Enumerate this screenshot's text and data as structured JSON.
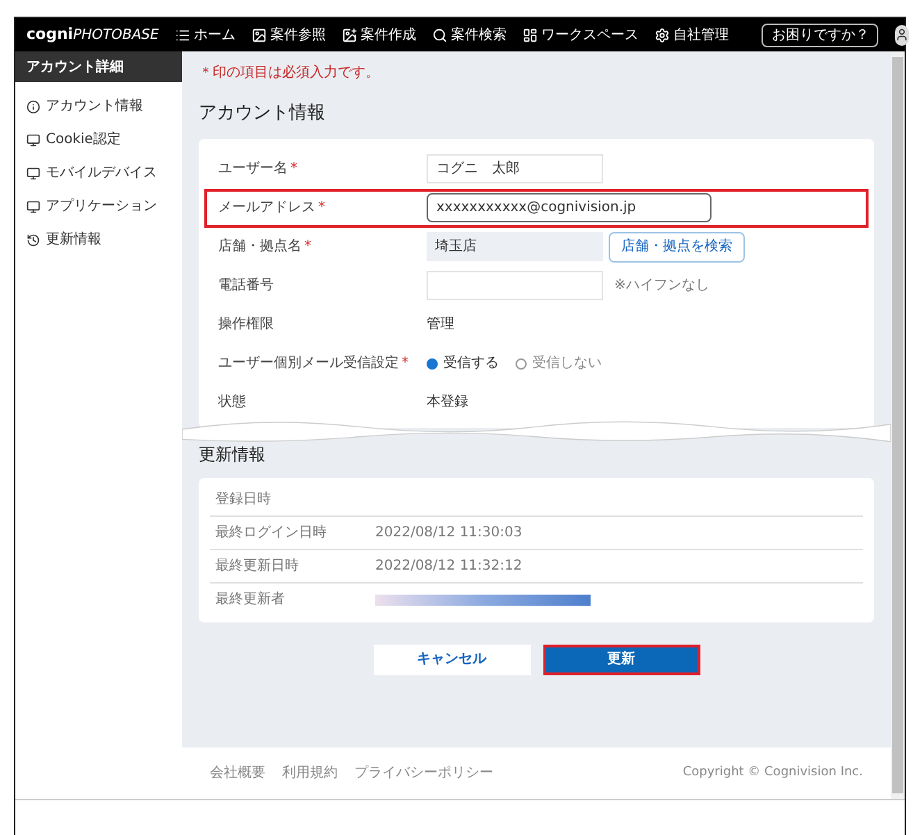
{
  "header": {
    "logo_main": "cogni",
    "logo_sub": "PHOTOBASE",
    "nav": [
      {
        "label": "ホーム"
      },
      {
        "label": "案件参照"
      },
      {
        "label": "案件作成"
      },
      {
        "label": "案件検索"
      },
      {
        "label": "ワークスペース"
      },
      {
        "label": "自社管理"
      }
    ],
    "help_button": "お困りですか？"
  },
  "sidebar": {
    "title": "アカウント詳細",
    "items": [
      {
        "label": "アカウント情報"
      },
      {
        "label": "Cookie認定"
      },
      {
        "label": "モバイルデバイス"
      },
      {
        "label": "アプリケーション"
      },
      {
        "label": "更新情報"
      }
    ]
  },
  "required_note": "＊印の項目は必須入力です。",
  "account_title": "アカウント情報",
  "fields": [
    {
      "kind": "input",
      "label": "ユーザー名",
      "mark": "*",
      "highlighted": false,
      "value": "コグニ　太郎"
    },
    {
      "kind": "input",
      "label": "メールアドレス",
      "mark": "*",
      "highlighted": true,
      "value": "xxxxxxxxxxx@cognivision.jp"
    },
    {
      "kind": "readonly",
      "label": "店舗・拠点名",
      "mark": "*",
      "highlighted": false,
      "value": "埼玉店",
      "button": "店舗・拠点を検索"
    },
    {
      "kind": "input",
      "label": "電話番号",
      "highlighted": false,
      "hint": "※ハイフンなし"
    },
    {
      "kind": "text",
      "label": "操作権限",
      "highlighted": false,
      "value": "管理"
    },
    {
      "kind": "radio",
      "label": "ユーザー個別メール受信設定",
      "mark": "*",
      "highlighted": false,
      "options": [
        {
          "label": "受信する",
          "selected": true
        },
        {
          "label": "受信しない",
          "selected": false
        }
      ]
    },
    {
      "kind": "text",
      "label": "状態",
      "highlighted": false,
      "value": "本登録"
    }
  ],
  "update_title": "更新情報",
  "update_rows": [
    {
      "label": "登録日時"
    },
    {
      "label": "最終ログイン日時",
      "value": "2022/08/12 11:30:03"
    },
    {
      "label": "最終更新日時",
      "value": "2022/08/12 11:32:12"
    },
    {
      "label": "最終更新者",
      "redacted": true
    }
  ],
  "buttons": [
    {
      "label": "キャンセル",
      "kind": "secondary",
      "highlighted": false
    },
    {
      "label": "更新",
      "kind": "primary",
      "highlighted": true
    }
  ],
  "footer": {
    "links": [
      "会社概要",
      "利用規約",
      "プライバシーポリシー"
    ],
    "copyright": "Copyright © Cognivision Inc."
  }
}
